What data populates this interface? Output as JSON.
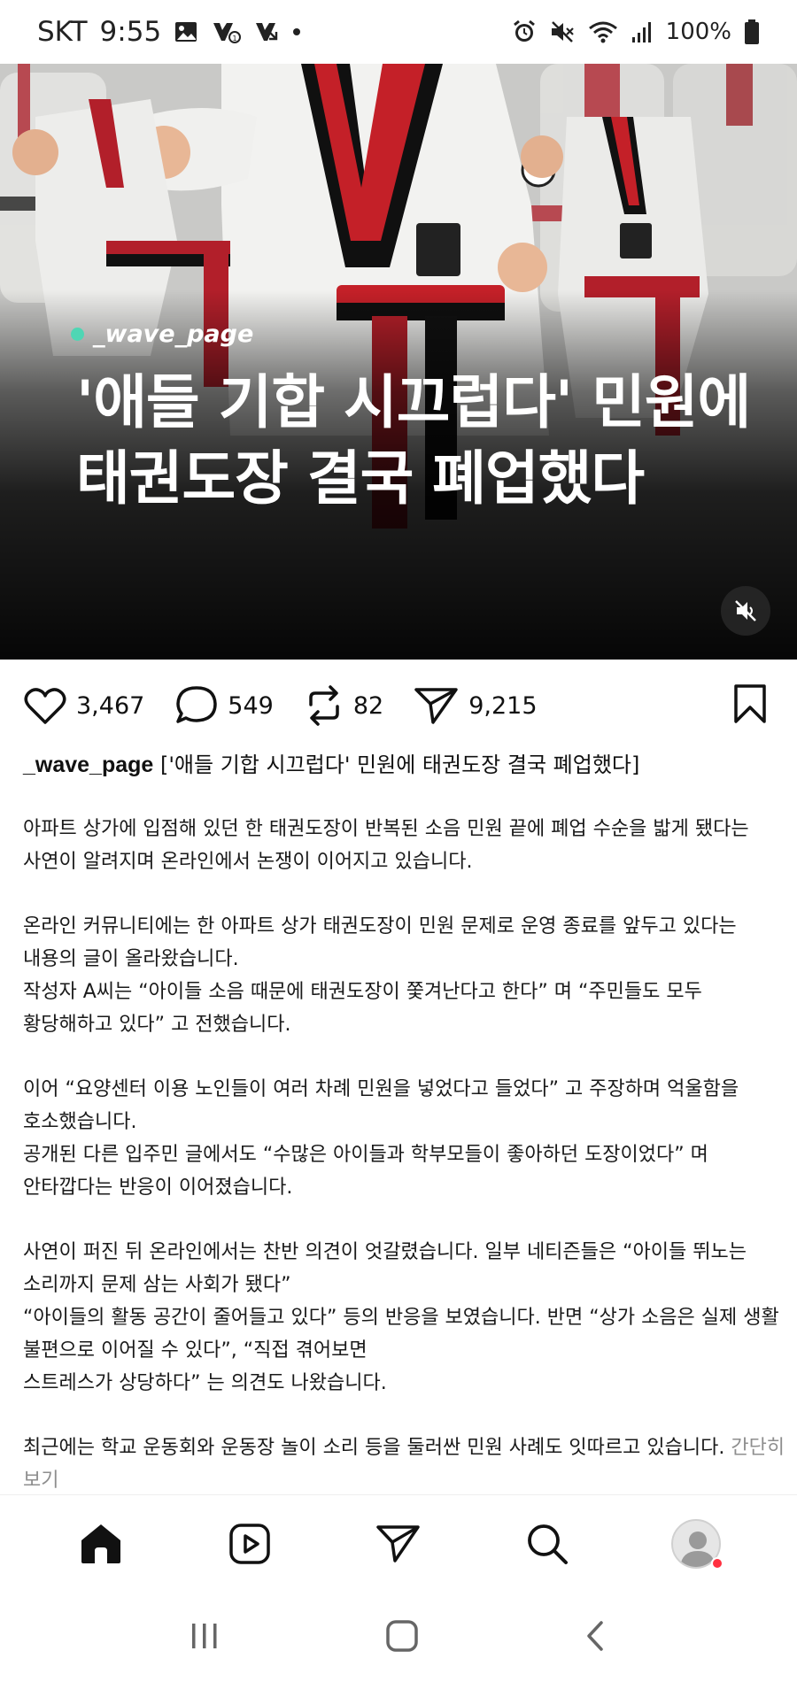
{
  "status_bar": {
    "carrier": "SKT",
    "time": "9:55",
    "battery": "100%",
    "icons_left": [
      "gallery-icon",
      "call-icon",
      "missed-call-icon",
      "dot-icon"
    ],
    "icons_right": [
      "alarm-icon",
      "mute-icon",
      "wifi-icon",
      "signal-icon",
      "battery-icon"
    ]
  },
  "post": {
    "hero": {
      "handle": "_wave_page",
      "title_line1": "'애들 기합 시끄럽다' 민원에",
      "title_line2": "태권도장 결국 폐업했다"
    },
    "actions": {
      "likes": "3,467",
      "comments": "549",
      "reposts": "82",
      "shares": "9,215"
    },
    "caption": {
      "username": "_wave_page",
      "headline": "['애들 기합 시끄럽다' 민원에 태권도장 결국 폐업했다]"
    },
    "paragraphs": [
      [
        "아파트 상가에 입점해 있던 한 태권도장이 반복된 소음 민원 끝에 폐업 수순을 밟게 됐다는",
        "사연이 알려지며 온라인에서 논쟁이 이어지고 있습니다."
      ],
      [
        "온라인 커뮤니티에는 한 아파트 상가 태권도장이 민원 문제로 운영 종료를 앞두고 있다는",
        "내용의 글이 올라왔습니다.",
        "작성자 A씨는 “아이들 소음 때문에 태권도장이 쫓겨난다고 한다” 며 “주민들도 모두",
        "황당해하고 있다” 고 전했습니다."
      ],
      [
        "이어 “요양센터 이용 노인들이 여러 차례 민원을 넣었다고 들었다” 고 주장하며 억울함을",
        "호소했습니다.",
        "공개된 다른 입주민 글에서도 “수많은 아이들과 학부모들이 좋아하던 도장이었다” 며",
        "안타깝다는 반응이 이어졌습니다."
      ],
      [
        "사연이 퍼진 뒤 온라인에서는 찬반 의견이 엇갈렸습니다. 일부 네티즌들은 “아이들 뛰노는",
        "소리까지 문제 삼는 사회가 됐다”",
        "“아이들의 활동 공간이 줄어들고 있다” 등의 반응을 보였습니다. 반면 “상가 소음은 실제 생활",
        "불편으로 이어질 수 있다”, “직접 겪어보면",
        "스트레스가 상당하다” 는 의견도 나왔습니다."
      ]
    ],
    "last_paragraph": "최근에는 학교 운동회와 운동장 놀이 소리 등을 둘러싼 민원 사례도 잇따르고 있습니다.",
    "collapse_label": "간단히",
    "collapse_label2": "보기"
  },
  "bottom_nav": [
    "home-icon",
    "reels-icon",
    "send-icon",
    "search-icon",
    "profile-avatar"
  ],
  "colors": {
    "accent_dot": "#4fd6b4",
    "notification": "#ff3040",
    "muted_text": "#8e8e8e"
  }
}
